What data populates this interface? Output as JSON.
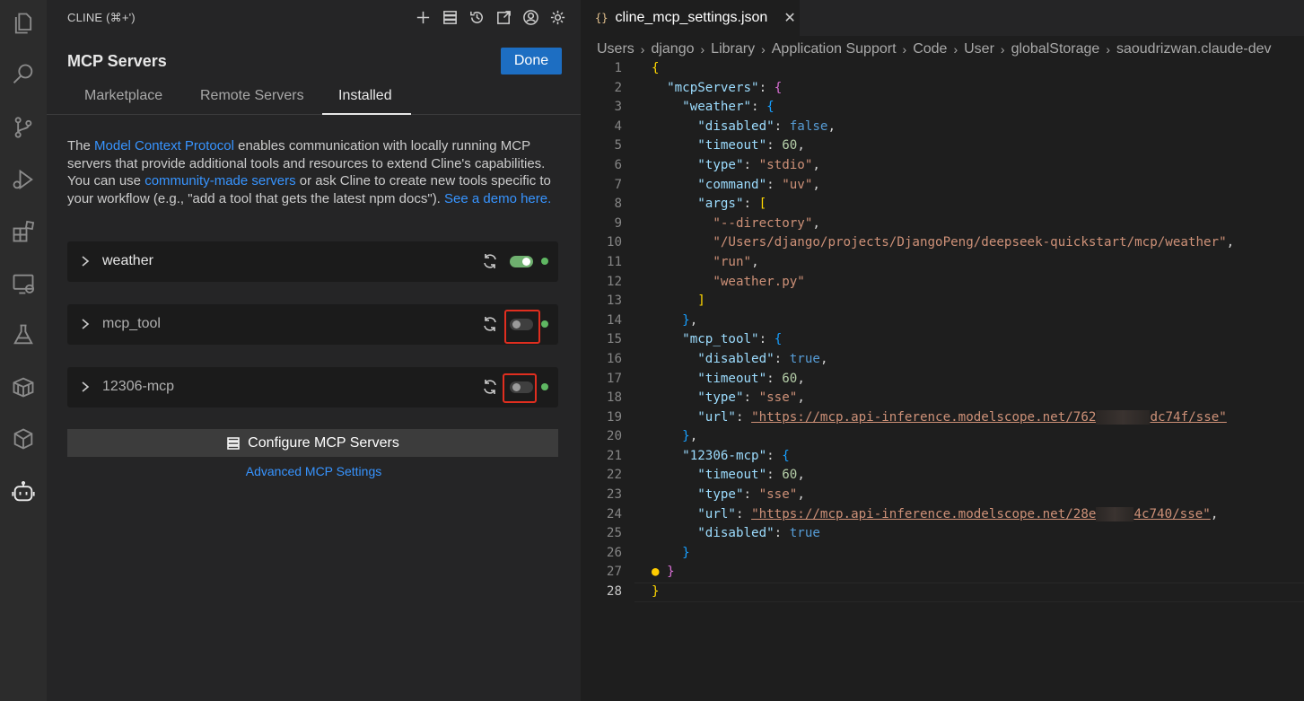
{
  "sidebar": {
    "header": "CLINE (⌘+')",
    "title": "MCP Servers",
    "done_label": "Done",
    "tabs": [
      {
        "label": "Marketplace"
      },
      {
        "label": "Remote Servers"
      },
      {
        "label": "Installed",
        "active": true
      }
    ],
    "intro": {
      "t1": "The ",
      "link1": "Model Context Protocol",
      "t2": " enables communication with locally running MCP servers that provide additional tools and resources to extend Cline's capabilities. You can use ",
      "link2": "community-made servers",
      "t3": " or ask Cline to create new tools specific to your workflow (e.g., \"add a tool that gets the latest npm docs\"). ",
      "link3": "See a demo here."
    },
    "servers": [
      {
        "name": "weather",
        "enabled": true
      },
      {
        "name": "mcp_tool",
        "enabled": false
      },
      {
        "name": "12306-mcp",
        "enabled": false
      }
    ],
    "configure_label": "Configure MCP Servers",
    "advanced_label": "Advanced MCP Settings"
  },
  "editor": {
    "tab_icon": "{}",
    "tab_name": "cline_mcp_settings.json",
    "close_glyph": "✕",
    "breadcrumb": [
      "Users",
      "django",
      "Library",
      "Application Support",
      "Code",
      "User",
      "globalStorage",
      "saoudrizwan.claude-dev"
    ],
    "line_numbers": [
      "1",
      "2",
      "3",
      "4",
      "5",
      "6",
      "7",
      "8",
      "9",
      "10",
      "11",
      "12",
      "13",
      "14",
      "15",
      "16",
      "17",
      "18",
      "19",
      "20",
      "21",
      "22",
      "23",
      "24",
      "25",
      "26",
      "27",
      "28"
    ],
    "tokens": {
      "mcpServers": "\"mcpServers\"",
      "weather": "\"weather\"",
      "disabled": "\"disabled\"",
      "timeout": "\"timeout\"",
      "type": "\"type\"",
      "command": "\"command\"",
      "args": "\"args\"",
      "url": "\"url\"",
      "mcp_tool": "\"mcp_tool\"",
      "mcp12306": "\"12306-mcp\"",
      "false": "false",
      "true": "true",
      "sixty": "60",
      "stdio": "\"stdio\"",
      "uv": "\"uv\"",
      "sse": "\"sse\"",
      "arg_directory": "\"--directory\"",
      "arg_path": "\"/Users/django/projects/DjangoPeng/deepseek-quickstart/mcp/weather\"",
      "arg_run": "\"run\"",
      "arg_py": "\"weather.py\"",
      "url1_a": "\"https://mcp.api-inference.modelscope.net/762",
      "url1_b": "dc74f/sse\"",
      "url2_a": "\"https://mcp.api-inference.modelscope.net/28e",
      "url2_b": "4c740/sse\""
    }
  }
}
